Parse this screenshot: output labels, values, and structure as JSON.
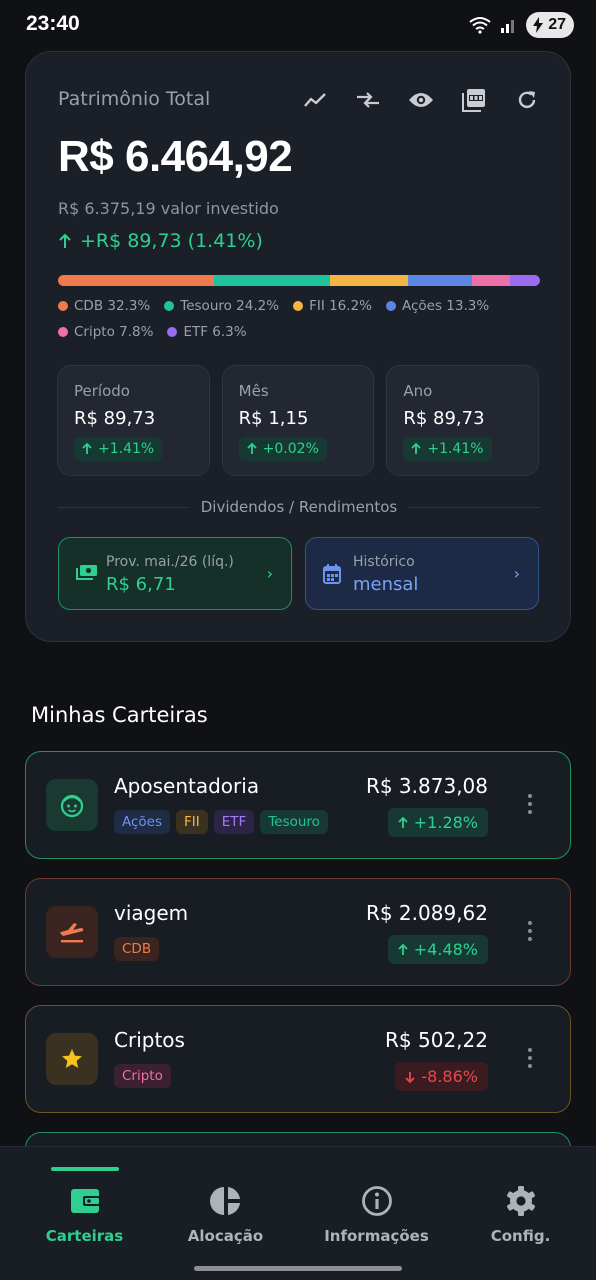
{
  "status_bar": {
    "time": "23:40",
    "battery": "27"
  },
  "summary": {
    "title": "Patrimônio Total",
    "actions": [
      "trend-chart-icon",
      "transfer-icon",
      "eye-icon",
      "pdf-icon",
      "refresh-icon"
    ],
    "total": "R$ 6.464,92",
    "invested": "R$ 6.375,19 valor investido",
    "gain": "+R$ 89,73 (1.41%)",
    "allocation": [
      {
        "label": "CDB 32.3%",
        "percent": 32.3,
        "color": "#f07a4f"
      },
      {
        "label": "Tesouro 24.2%",
        "percent": 24.2,
        "color": "#1fc39b"
      },
      {
        "label": "FII 16.2%",
        "percent": 16.2,
        "color": "#f4b544"
      },
      {
        "label": "Ações 13.3%",
        "percent": 13.3,
        "color": "#5b86e6"
      },
      {
        "label": "Cripto 7.8%",
        "percent": 7.8,
        "color": "#ef6fa8"
      },
      {
        "label": "ETF 6.3%",
        "percent": 6.3,
        "color": "#9b6bf2"
      }
    ],
    "periods": [
      {
        "label": "Período",
        "value": "R$ 89,73",
        "change": "+1.41%"
      },
      {
        "label": "Mês",
        "value": "R$ 1,15",
        "change": "+0.02%"
      },
      {
        "label": "Ano",
        "value": "R$ 89,73",
        "change": "+1.41%"
      }
    ],
    "dividends_title": "Dividendos / Rendimentos",
    "provisioned": {
      "label": "Prov. mai./26 (líq.)",
      "value": "R$ 6,71"
    },
    "history": {
      "label": "Histórico",
      "value": "mensal"
    }
  },
  "wallets_title": "Minhas Carteiras",
  "wallets": [
    {
      "name": "Aposentadoria",
      "icon": "face-icon",
      "value": "R$ 3.873,08",
      "change": "+1.28%",
      "trend": "up",
      "accent": "#1f8f66",
      "tags": [
        {
          "label": "Ações",
          "color": "#6f93ee",
          "bg": "#1f2c46"
        },
        {
          "label": "FII",
          "color": "#f4b544",
          "bg": "#3a3120"
        },
        {
          "label": "ETF",
          "color": "#a27df2",
          "bg": "#2c2446"
        },
        {
          "label": "Tesouro",
          "color": "#1fc39b",
          "bg": "#163a33"
        }
      ]
    },
    {
      "name": "viagem",
      "icon": "airplane-icon",
      "value": "R$ 2.089,62",
      "change": "+4.48%",
      "trend": "up",
      "accent": "#7a3e30",
      "tags": [
        {
          "label": "CDB",
          "color": "#f07a4f",
          "bg": "#3a2420"
        }
      ]
    },
    {
      "name": "Criptos",
      "icon": "star-icon",
      "value": "R$ 502,22",
      "change": "-8.86%",
      "trend": "down",
      "accent": "#7a6424",
      "tags": [
        {
          "label": "Cripto",
          "color": "#ef6fa8",
          "bg": "#3a2030"
        }
      ]
    }
  ],
  "bottom_nav": [
    {
      "label": "Carteiras",
      "icon": "wallet-icon",
      "active": true
    },
    {
      "label": "Alocação",
      "icon": "pie-chart-icon",
      "active": false
    },
    {
      "label": "Informações",
      "icon": "info-icon",
      "active": false
    },
    {
      "label": "Config.",
      "icon": "gear-icon",
      "active": false
    }
  ],
  "colors": {
    "accent_green": "#2fd08f",
    "negative_red": "#e5484d",
    "background": "#0f1115"
  }
}
